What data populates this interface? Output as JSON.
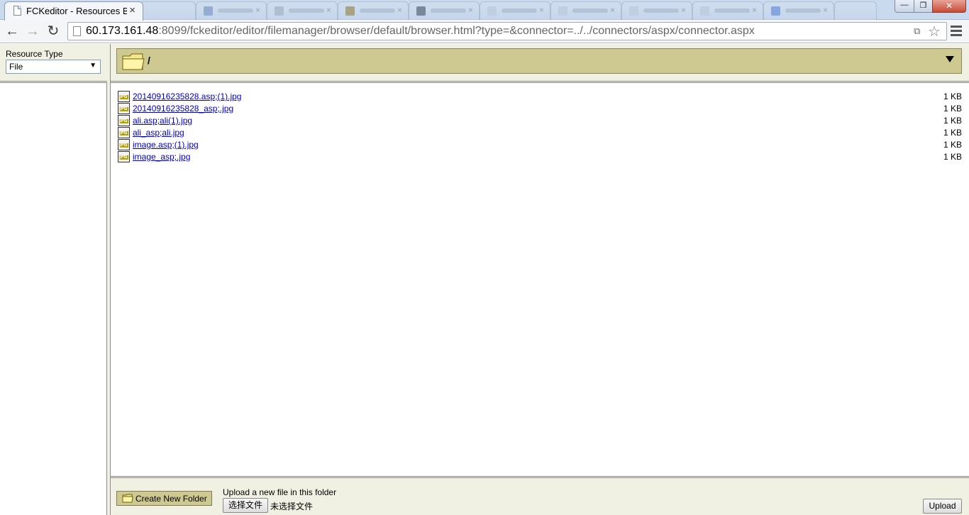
{
  "browser": {
    "active_tab": {
      "title": "FCKeditor - Resources B",
      "close_glyph": "×"
    },
    "window_controls": {
      "minimize": "—",
      "maximize": "❐",
      "close": "✕"
    },
    "nav": {
      "back": "←",
      "forward": "→",
      "reload": "↻"
    },
    "address": {
      "host": "60.173.161.48",
      "rest": ":8099/fckeditor/editor/filemanager/browser/default/browser.html?type=&connector=../../connectors/aspx/connector.aspx"
    },
    "icons": {
      "translate": "translate-icon",
      "star": "star-icon",
      "menu": "menu-icon"
    }
  },
  "sidebar": {
    "resource_type_label": "Resource Type",
    "resource_type_value": "File",
    "dropdown_arrow": "▼"
  },
  "folder_bar": {
    "path": "/"
  },
  "files": [
    {
      "name": "20140916235828.asp;(1).jpg",
      "size": "1 KB"
    },
    {
      "name": "20140916235828_asp;.jpg",
      "size": "1 KB"
    },
    {
      "name": "ali.asp;ali(1).jpg",
      "size": "1 KB"
    },
    {
      "name": "ali_asp;ali.jpg",
      "size": "1 KB"
    },
    {
      "name": "image.asp;(1).jpg",
      "size": "1 KB"
    },
    {
      "name": "image_asp;.jpg",
      "size": "1 KB"
    }
  ],
  "footer": {
    "create_folder_label": "Create New Folder",
    "upload_label": "Upload a new file in this folder",
    "choose_file_label": "选择文件",
    "no_file_text": "未选择文件",
    "upload_button_label": "Upload"
  },
  "colors": {
    "panel": "#f1f1e3",
    "folder_bar": "#cdc990",
    "link": "#0000cc"
  }
}
